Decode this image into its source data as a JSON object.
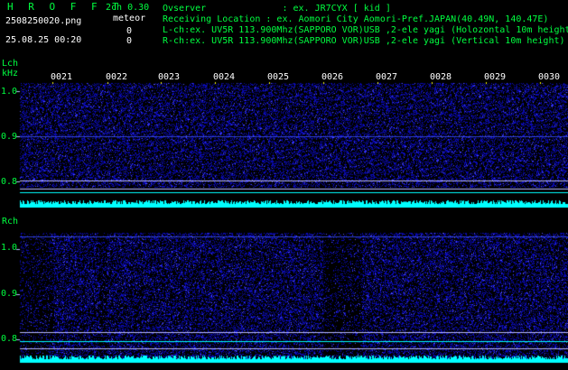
{
  "header": {
    "logo": "H R O F F T",
    "mode": "2ch 0.30",
    "filename": "2508250020.png",
    "meteor_label": "meteor",
    "meteor_count_l": "0",
    "timestamp": "25.08.25 00:20",
    "meteor_count_r": "0",
    "observer": "Ovserver              : ex. JR7CYX [ kid ]",
    "location": "Receiving Location : ex. Aomori City Aomori-Pref.JAPAN(40.49N, 140.47E)",
    "lch_info": "L-ch:ex. UV5R 113.900Mhz(SAPPORO VOR)USB ,2-ele yagi (Holozontal 10m height)",
    "rch_info": "R-ch:ex. UV5R 113.900Mhz(SAPPORO VOR)USB ,2-ele yagi (Vertical 10m height)"
  },
  "lch": {
    "label": "Lch",
    "unit": "kHz",
    "ticks": [
      "1.0",
      "0.9",
      "0.8"
    ]
  },
  "rch": {
    "label": "Rch",
    "ticks": [
      "1.0",
      "0.9",
      "0.8"
    ]
  },
  "time_marks": [
    "0021",
    "0022",
    "0023",
    "0024",
    "0025",
    "0026",
    "0027",
    "0028",
    "0029",
    "0030"
  ],
  "colors": {
    "background": "#000000",
    "label_green": "#00ff40",
    "noise_blue": "#2020ff",
    "signal_cyan": "#00ffff",
    "tick_yellow": "#ffff00"
  }
}
